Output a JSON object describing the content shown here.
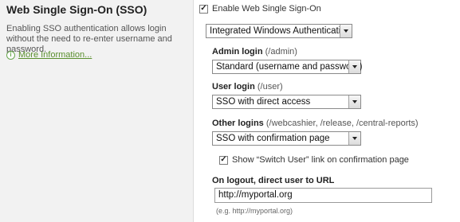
{
  "section": {
    "title": "Web Single Sign-On (SSO)",
    "description": "Enabling SSO authentication allows login without the need to re-enter username and password.",
    "more_info_label": "More Information..."
  },
  "sso": {
    "enable_label": "Enable Web Single Sign-On",
    "enabled": true,
    "method_selected": "Integrated Windows Authentication"
  },
  "admin_login": {
    "label": "Admin login",
    "hint": "(/admin)",
    "selected": "Standard (username and password)"
  },
  "user_login": {
    "label": "User login",
    "hint": "(/user)",
    "selected": "SSO with direct access"
  },
  "other_logins": {
    "label": "Other logins",
    "hint": "(/webcashier, /release, /central-reports)",
    "selected": "SSO with confirmation page",
    "switch_user_label": "Show “Switch User” link on confirmation page",
    "switch_user_checked": true
  },
  "logout": {
    "label": "On logout, direct user to URL",
    "value": "http://myportal.org",
    "example": "(e.g. http://myportal.org)"
  },
  "colors": {
    "link": "#5a8f2e",
    "left_pane_bg": "#f2f2f2"
  }
}
